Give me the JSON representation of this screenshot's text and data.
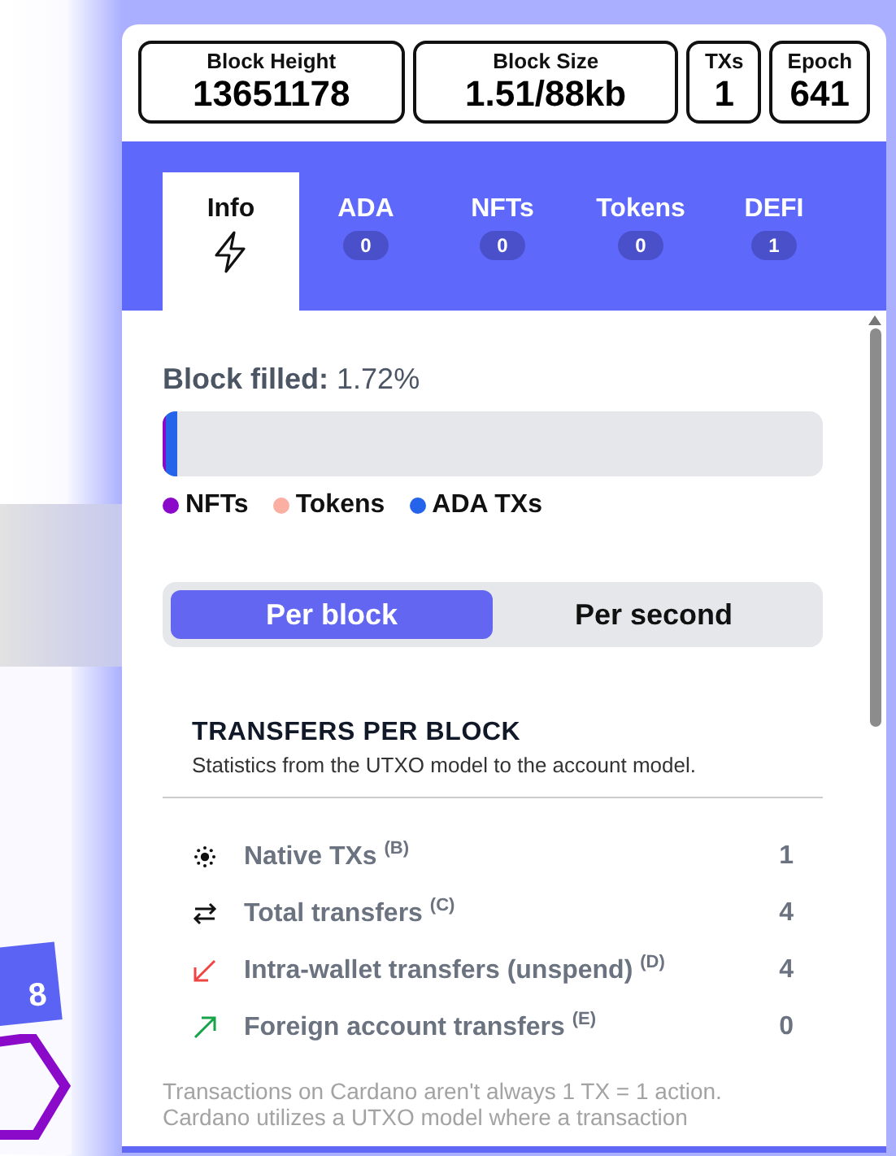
{
  "background": {
    "card_text": "8"
  },
  "stats": [
    {
      "label": "Block Height",
      "value": "13651178"
    },
    {
      "label": "Block Size",
      "value": "1.51/88kb"
    },
    {
      "label": "TXs",
      "value": "1"
    },
    {
      "label": "Epoch",
      "value": "641"
    }
  ],
  "tabs": [
    {
      "label": "Info",
      "kind": "icon",
      "selected": true
    },
    {
      "label": "ADA",
      "kind": "count",
      "count": "0",
      "selected": false
    },
    {
      "label": "NFTs",
      "kind": "count",
      "count": "0",
      "selected": false
    },
    {
      "label": "Tokens",
      "kind": "count",
      "count": "0",
      "selected": false
    },
    {
      "label": "DEFI",
      "kind": "count",
      "count": "1",
      "selected": false
    }
  ],
  "block_filled": {
    "label": "Block filled:",
    "value": "1.72%",
    "level": 0.0172
  },
  "legend": [
    {
      "label": "NFTs",
      "color": "#8b0ac9"
    },
    {
      "label": "Tokens",
      "color": "#fbaea2"
    },
    {
      "label": "ADA TXs",
      "color": "#2563eb"
    }
  ],
  "toggle": [
    {
      "label": "Per block",
      "selected": true
    },
    {
      "label": "Per second",
      "selected": false
    }
  ],
  "section": {
    "title": "TRANSFERS PER BLOCK",
    "subtitle": "Statistics from the UTXO model to the account model."
  },
  "stats_rows": [
    {
      "kind": "native",
      "label": "Native TXs $^{(B)}$",
      "value": "1"
    },
    {
      "kind": "swap",
      "label": "Total transfers $^{(C)}$",
      "value": "4"
    },
    {
      "kind": "down",
      "label": "Intra-wallet transfers (unspend) $^{(D)}$",
      "value": "4"
    },
    {
      "kind": "up",
      "label": "Foreign account transfers $^{(E)}$",
      "value": "0"
    }
  ],
  "note": [
    "Transactions on Cardano aren't always 1 TX = 1 action.",
    "Cardano utilizes a UTXO model where a transaction"
  ]
}
